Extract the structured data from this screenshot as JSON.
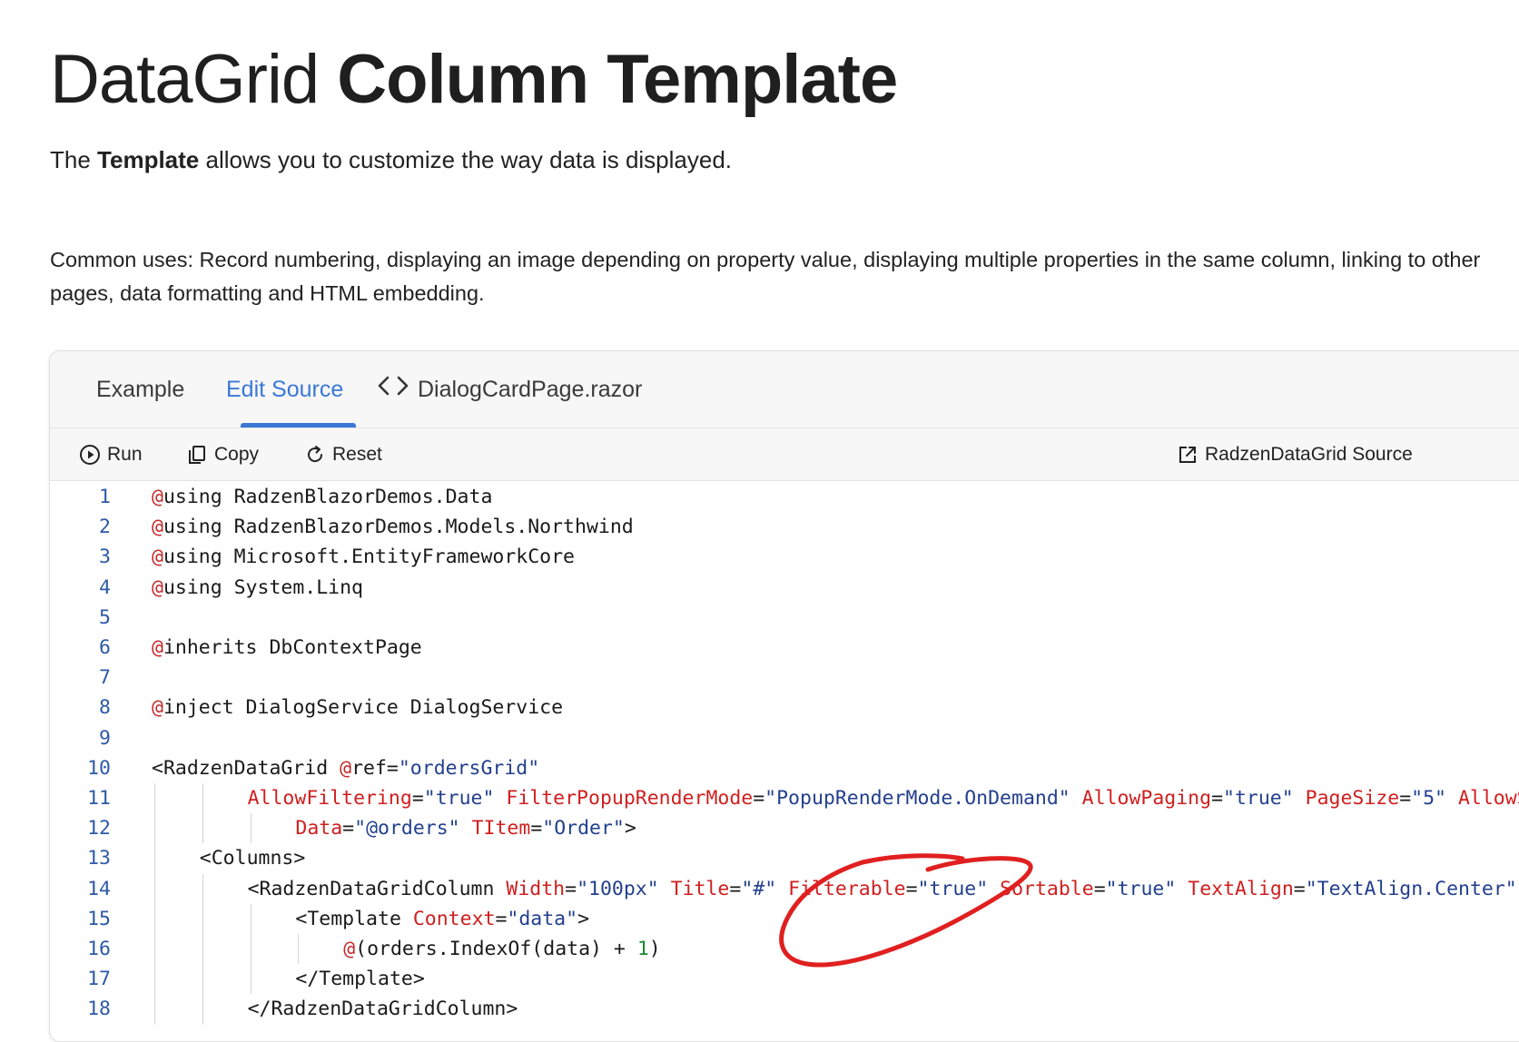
{
  "page": {
    "title_light": "DataGrid",
    "title_bold": "Column Template",
    "intro_pre": "The",
    "intro_bold": "Template",
    "intro_post": "allows you to customize the way data is displayed.",
    "common_uses": "Common uses: Record numbering, displaying an image depending on property value, displaying multiple properties in the same column, linking to other pages, data formatting and HTML embedding."
  },
  "tabs": [
    {
      "label": "Example",
      "active": false
    },
    {
      "label": "Edit Source",
      "active": true
    },
    {
      "label": "DialogCardPage.razor",
      "active": false,
      "icon": "code-icon"
    }
  ],
  "toolbar": {
    "run": {
      "label": "Run",
      "icon": "play-circle-icon"
    },
    "copy": {
      "label": "Copy",
      "icon": "copy-icon"
    },
    "reset": {
      "label": "Reset",
      "icon": "refresh-icon"
    },
    "source": {
      "label": "RadzenDataGrid Source",
      "icon": "external-link-icon"
    }
  },
  "colors": {
    "accent": "#3a78d6",
    "code_keyword": "#c62828",
    "code_string": "#23408e",
    "code_number": "#1a8a2e",
    "annotation": "#e02020"
  },
  "code_lines": [
    {
      "n": "1",
      "indent": 0,
      "tokens": [
        [
          "at",
          "@"
        ],
        [
          "t",
          "using RadzenBlazorDemos.Data"
        ]
      ]
    },
    {
      "n": "2",
      "indent": 0,
      "tokens": [
        [
          "at",
          "@"
        ],
        [
          "t",
          "using RadzenBlazorDemos.Models.Northwind"
        ]
      ]
    },
    {
      "n": "3",
      "indent": 0,
      "tokens": [
        [
          "at",
          "@"
        ],
        [
          "t",
          "using Microsoft.EntityFrameworkCore"
        ]
      ]
    },
    {
      "n": "4",
      "indent": 0,
      "tokens": [
        [
          "at",
          "@"
        ],
        [
          "t",
          "using System.Linq"
        ]
      ]
    },
    {
      "n": "5",
      "indent": 0,
      "tokens": []
    },
    {
      "n": "6",
      "indent": 0,
      "tokens": [
        [
          "at",
          "@"
        ],
        [
          "t",
          "inherits DbContextPage"
        ]
      ]
    },
    {
      "n": "7",
      "indent": 0,
      "tokens": []
    },
    {
      "n": "8",
      "indent": 0,
      "tokens": [
        [
          "at",
          "@"
        ],
        [
          "t",
          "inject DialogService DialogService"
        ]
      ]
    },
    {
      "n": "9",
      "indent": 0,
      "tokens": []
    },
    {
      "n": "10",
      "indent": 0,
      "tokens": [
        [
          "t",
          "<RadzenDataGrid "
        ],
        [
          "at",
          "@"
        ],
        [
          "t",
          "ref"
        ],
        [
          "t",
          "="
        ],
        [
          "str",
          "\"ordersGrid\""
        ]
      ]
    },
    {
      "n": "11",
      "indent": 8,
      "tokens": [
        [
          "attr",
          "AllowFiltering"
        ],
        [
          "t",
          "="
        ],
        [
          "str",
          "\"true\""
        ],
        [
          "t",
          " "
        ],
        [
          "attr",
          "FilterPopupRenderMode"
        ],
        [
          "t",
          "="
        ],
        [
          "str",
          "\"PopupRenderMode.OnDemand\""
        ],
        [
          "t",
          " "
        ],
        [
          "attr",
          "AllowPaging"
        ],
        [
          "t",
          "="
        ],
        [
          "str",
          "\"true\""
        ],
        [
          "t",
          " "
        ],
        [
          "attr",
          "PageSize"
        ],
        [
          "t",
          "="
        ],
        [
          "str",
          "\"5\""
        ],
        [
          "t",
          " "
        ],
        [
          "attr",
          "AllowSorting"
        ]
      ]
    },
    {
      "n": "12",
      "indent": 12,
      "tokens": [
        [
          "attr",
          "Data"
        ],
        [
          "t",
          "="
        ],
        [
          "str",
          "\"@orders\""
        ],
        [
          "t",
          " "
        ],
        [
          "attr",
          "TItem"
        ],
        [
          "t",
          "="
        ],
        [
          "str",
          "\"Order\""
        ],
        [
          "t",
          ">"
        ]
      ]
    },
    {
      "n": "13",
      "indent": 4,
      "tokens": [
        [
          "t",
          "<Columns>"
        ]
      ]
    },
    {
      "n": "14",
      "indent": 8,
      "tokens": [
        [
          "t",
          "<RadzenDataGridColumn "
        ],
        [
          "attr",
          "Width"
        ],
        [
          "t",
          "="
        ],
        [
          "str",
          "\"100px\""
        ],
        [
          "t",
          " "
        ],
        [
          "attr",
          "Title"
        ],
        [
          "t",
          "="
        ],
        [
          "str",
          "\"#\""
        ],
        [
          "t",
          " "
        ],
        [
          "attr",
          "Filterable"
        ],
        [
          "t",
          "="
        ],
        [
          "str",
          "\"true\""
        ],
        [
          "t",
          " "
        ],
        [
          "attr",
          "Sortable"
        ],
        [
          "t",
          "="
        ],
        [
          "str",
          "\"true\""
        ],
        [
          "t",
          " "
        ],
        [
          "attr",
          "TextAlign"
        ],
        [
          "t",
          "="
        ],
        [
          "str",
          "\"TextAlign.Center\""
        ]
      ]
    },
    {
      "n": "15",
      "indent": 12,
      "tokens": [
        [
          "t",
          "<Template "
        ],
        [
          "attr",
          "Context"
        ],
        [
          "t",
          "="
        ],
        [
          "str",
          "\"data\""
        ],
        [
          "t",
          ">"
        ]
      ]
    },
    {
      "n": "16",
      "indent": 16,
      "tokens": [
        [
          "at",
          "@"
        ],
        [
          "t",
          "(orders.IndexOf(data) + "
        ],
        [
          "num",
          "1"
        ],
        [
          "t",
          ")"
        ]
      ]
    },
    {
      "n": "17",
      "indent": 12,
      "tokens": [
        [
          "t",
          "</Template>"
        ]
      ]
    },
    {
      "n": "18",
      "indent": 8,
      "tokens": [
        [
          "t",
          "</RadzenDataGridColumn>"
        ]
      ]
    }
  ]
}
